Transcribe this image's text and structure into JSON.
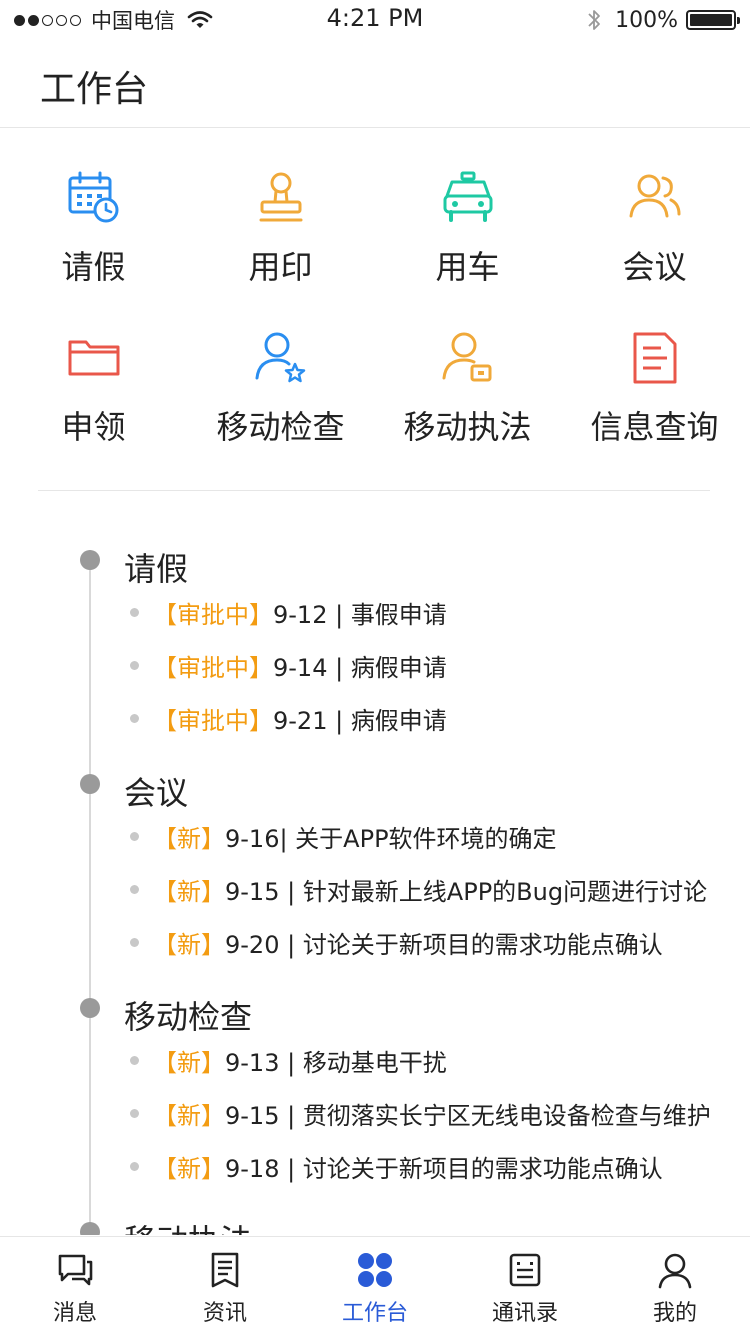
{
  "status_bar": {
    "carrier": "中国电信",
    "time": "4:21 PM",
    "battery": "100%"
  },
  "header": {
    "title": "工作台"
  },
  "grid": [
    {
      "label": "请假",
      "icon": "calendar-clock-icon",
      "color": "#2a8ef0"
    },
    {
      "label": "用印",
      "icon": "stamp-icon",
      "color": "#f0a93a"
    },
    {
      "label": "用车",
      "icon": "car-icon",
      "color": "#1ec9a3"
    },
    {
      "label": "会议",
      "icon": "people-icon",
      "color": "#f0a93a"
    },
    {
      "label": "申领",
      "icon": "folder-icon",
      "color": "#e9574a"
    },
    {
      "label": "移动检查",
      "icon": "user-star-icon",
      "color": "#2a8ef0"
    },
    {
      "label": "移动执法",
      "icon": "user-badge-icon",
      "color": "#f0a93a"
    },
    {
      "label": "信息查询",
      "icon": "document-icon",
      "color": "#e9574a"
    }
  ],
  "timeline": [
    {
      "title": "请假",
      "items": [
        {
          "tag": "【审批中】",
          "text": "9-12 | 事假申请"
        },
        {
          "tag": "【审批中】",
          "text": "9-14 | 病假申请"
        },
        {
          "tag": "【审批中】",
          "text": "9-21 | 病假申请"
        }
      ]
    },
    {
      "title": "会议",
      "items": [
        {
          "tag": "【新】",
          "text": "9-16| 关于APP软件环境的确定"
        },
        {
          "tag": "【新】",
          "text": "9-15 | 针对最新上线APP的Bug问题进行讨论"
        },
        {
          "tag": "【新】",
          "text": "9-20 | 讨论关于新项目的需求功能点确认"
        }
      ]
    },
    {
      "title": "移动检查",
      "items": [
        {
          "tag": "【新】",
          "text": "9-13 | 移动基电干扰"
        },
        {
          "tag": "【新】",
          "text": "9-15 | 贯彻落实长宁区无线电设备检查与维护"
        },
        {
          "tag": "【新】",
          "text": "9-18 | 讨论关于新项目的需求功能点确认"
        }
      ]
    },
    {
      "title": "移动执法",
      "items": []
    }
  ],
  "tabs": [
    {
      "label": "消息",
      "icon": "chat-icon",
      "active": false
    },
    {
      "label": "资讯",
      "icon": "news-icon",
      "active": false
    },
    {
      "label": "工作台",
      "icon": "workbench-icon",
      "active": true
    },
    {
      "label": "通讯录",
      "icon": "contacts-icon",
      "active": false
    },
    {
      "label": "我的",
      "icon": "profile-icon",
      "active": false
    }
  ],
  "colors": {
    "accent": "#2a5bd7",
    "tag": "#f39c12"
  }
}
